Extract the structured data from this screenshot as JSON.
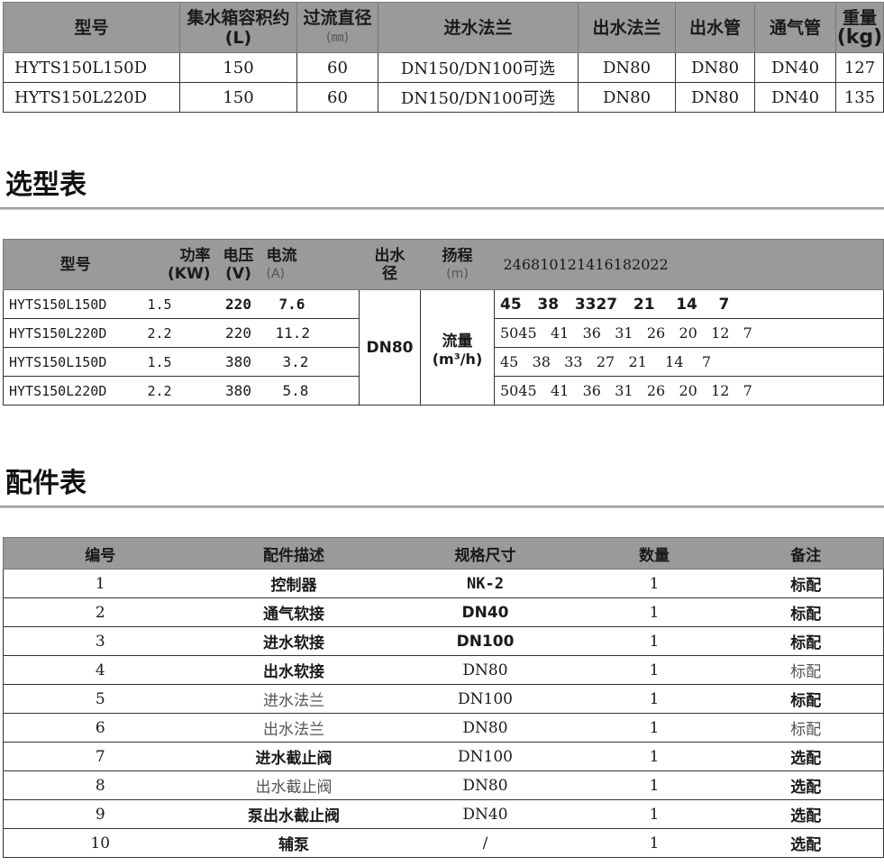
{
  "spec_table": {
    "headers": [
      "型号",
      "集水箱容积约(L)",
      "过流直径",
      "(㎜)",
      "进水法兰",
      "出水法兰",
      "出水管",
      "通气管",
      "重量",
      "(kg)"
    ],
    "rows": [
      [
        "HYTS150L150D",
        "150",
        "60",
        "DN150/DN100可选",
        "DN80",
        "DN80",
        "DN40",
        "127"
      ],
      [
        "HYTS150L220D",
        "150",
        "60",
        "DN150/DN100可选",
        "DN80",
        "DN80",
        "DN40",
        "135"
      ]
    ]
  },
  "selection": {
    "title": "选型表",
    "headers": {
      "model": "型号",
      "power": "功率",
      "power_unit": "(KW)",
      "voltage": "电压",
      "voltage_unit": "(V)",
      "current": "电流",
      "current_unit": "(A)",
      "outlet": "出水",
      "outlet2": "径",
      "lift": "扬程",
      "lift_unit": "(m)",
      "lift_values": "246810121416182022"
    },
    "outlet_value": "DN80",
    "flow_label": "流量",
    "flow_unit": "(m³/h)",
    "rows": [
      {
        "model": "HYTS150L150D",
        "power": "1.5",
        "voltage": "220",
        "current": "7.6",
        "flows": "45   38   3327   21    14    7",
        "bold": true
      },
      {
        "model": "HYTS150L220D",
        "power": "2.2",
        "voltage": "220",
        "current": "11.2",
        "flows": "5045   41   36   31   26   20   12   7",
        "bold": false
      },
      {
        "model": "HYTS150L150D",
        "power": "1.5",
        "voltage": "380",
        "current": "3.2",
        "flows": "45   38   33   27   21    14    7",
        "bold": false
      },
      {
        "model": "HYTS150L220D",
        "power": "2.2",
        "voltage": "380",
        "current": "5.8",
        "flows": "5045   41   36   31   26   20   12   7",
        "bold": false
      }
    ]
  },
  "parts": {
    "title": "配件表",
    "headers": [
      "编号",
      "配件描述",
      "规格尺寸",
      "数量",
      "备注"
    ],
    "rows": [
      [
        "1",
        "控制器",
        "NK-2",
        "1",
        "标配"
      ],
      [
        "2",
        "通气软接",
        "DN40",
        "1",
        "标配"
      ],
      [
        "3",
        "进水软接",
        "DN100",
        "1",
        "标配"
      ],
      [
        "4",
        "出水软接",
        "DN80",
        "1",
        "标配"
      ],
      [
        "5",
        "进水法兰",
        "DN100",
        "1",
        "标配"
      ],
      [
        "6",
        "出水法兰",
        "DN80",
        "1",
        "标配"
      ],
      [
        "7",
        "进水截止阀",
        "DN100",
        "1",
        "选配"
      ],
      [
        "8",
        "出水截止阀",
        "DN80",
        "1",
        "选配"
      ],
      [
        "9",
        "泵出水截止阀",
        "DN40",
        "1",
        "选配"
      ],
      [
        "10",
        "辅泵",
        "/",
        "1",
        "选配"
      ]
    ]
  }
}
